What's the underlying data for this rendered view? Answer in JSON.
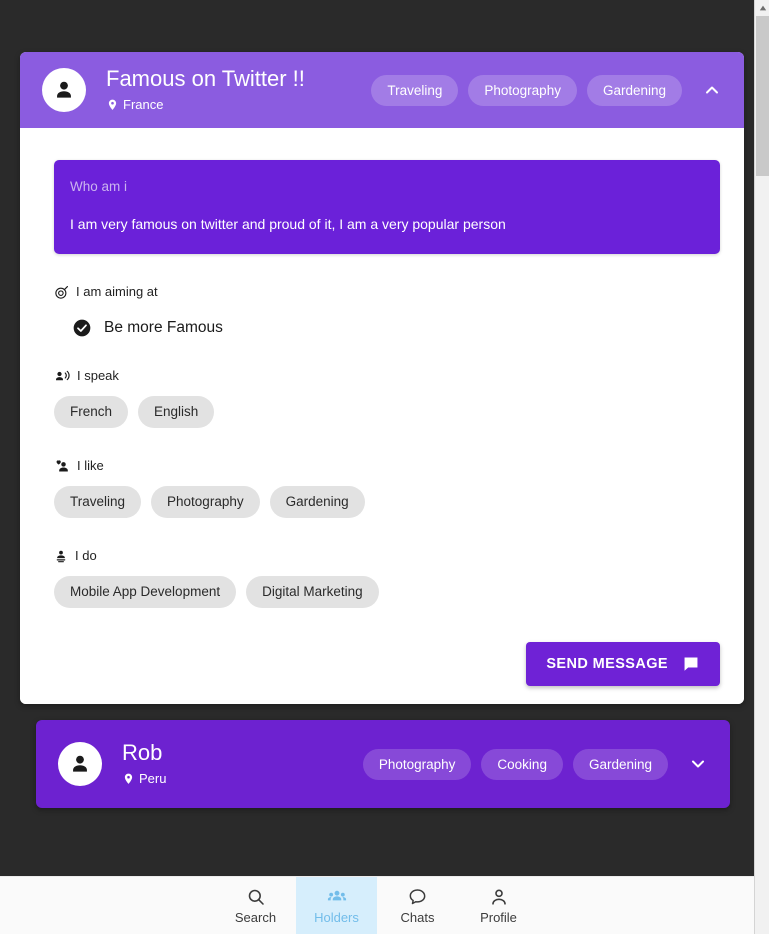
{
  "theme": {
    "page_background": "#2a2a2a",
    "header_purple": "#8b5ce0",
    "bio_purple": "#6b21d9",
    "collapsed_purple": "#6d22d0",
    "button_purple": "#6f22d6",
    "chip_grey": "#e2e2e2",
    "nav_active_bg": "#d6eefc",
    "nav_active_fg": "#72bdea"
  },
  "expanded_profile": {
    "avatar_icon": "person-icon",
    "name": "Famous on Twitter !!",
    "location_icon": "location-pin-icon",
    "location": "France",
    "tags": [
      "Traveling",
      "Photography",
      "Gardening"
    ],
    "collapse_icon": "chevron-up-icon",
    "bio": {
      "label": "Who am i",
      "text": "I am very famous on twitter and proud of it, I am a very popular person"
    },
    "sections": [
      {
        "icon": "target-icon",
        "title": "I am aiming at",
        "kind": "goal",
        "goal_icon": "check-circle-icon",
        "goal": "Be more Famous"
      },
      {
        "icon": "voice-over-icon",
        "title": "I speak",
        "kind": "chips",
        "chips": [
          "French",
          "English"
        ]
      },
      {
        "icon": "person-heart-icon",
        "title": "I like",
        "kind": "chips",
        "chips": [
          "Traveling",
          "Photography",
          "Gardening"
        ]
      },
      {
        "icon": "person-work-icon",
        "title": "I do",
        "kind": "chips",
        "chips": [
          "Mobile App Development",
          "Digital Marketing"
        ]
      }
    ],
    "send_button": {
      "label": "SEND MESSAGE",
      "icon": "chat-bubble-icon"
    }
  },
  "collapsed_profile": {
    "avatar_icon": "person-icon",
    "name": "Rob",
    "location_icon": "location-pin-icon",
    "location": "Peru",
    "tags": [
      "Photography",
      "Cooking",
      "Gardening"
    ],
    "expand_icon": "chevron-down-icon"
  },
  "bottom_nav": {
    "active_index": 1,
    "items": [
      {
        "label": "Search",
        "icon": "search-icon"
      },
      {
        "label": "Holders",
        "icon": "group-icon"
      },
      {
        "label": "Chats",
        "icon": "chat-icon"
      },
      {
        "label": "Profile",
        "icon": "person-outline-icon"
      }
    ]
  }
}
